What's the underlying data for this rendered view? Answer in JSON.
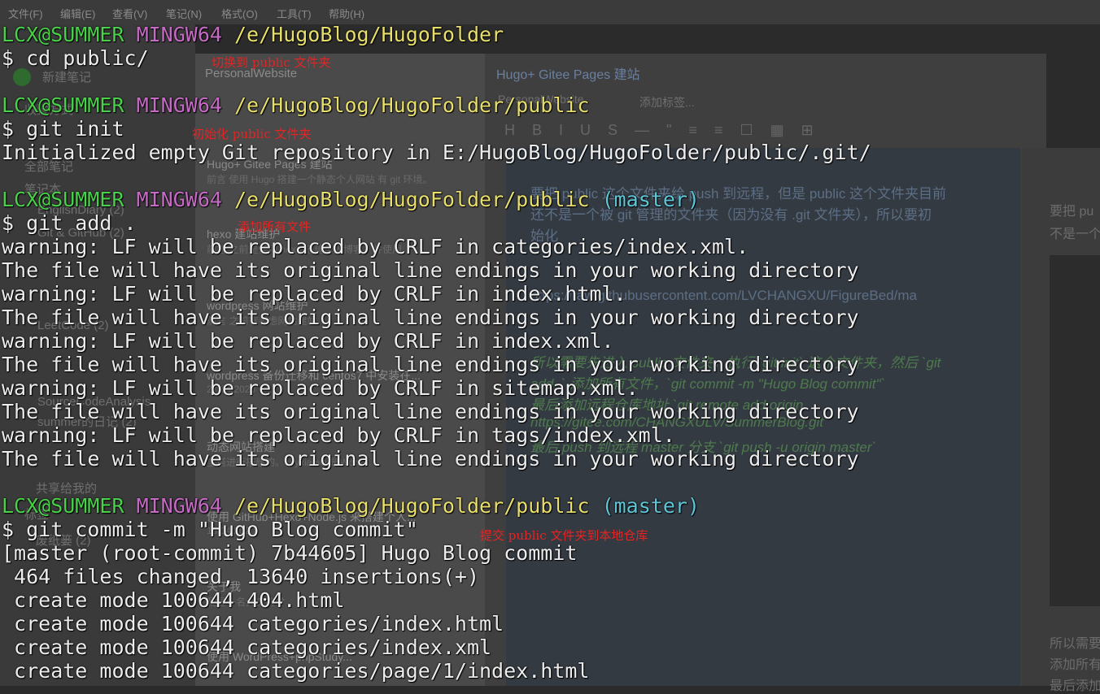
{
  "menu": [
    "文件(F)",
    "编辑(E)",
    "查看(V)",
    "笔记(N)",
    "格式(O)",
    "工具(T)",
    "帮助(H)"
  ],
  "sidebar": {
    "new_note": "新建笔记",
    "notebook_selector": "PersonalWebsite",
    "items": [
      "收藏方式",
      "全部笔记",
      "笔记本",
      "EnglishDiary (2)",
      "Git & GitHub (2)",
      "LeetCode (2)",
      "SourceCodeAnalysis",
      "summer的日记 (2)",
      "共享给我的",
      "标签",
      "废纸篓 (2)"
    ]
  },
  "note_list": [
    {
      "title": "Hugo+ Gitee Pages 建站",
      "snippet": "前言 使用 Hugo 搭建一个静态个人网站 有 git 环境。"
    },
    {
      "title": "hexo 建站维护",
      "snippet": "前言 之前是使用 hexo 搭建个人博客，并使用..."
    },
    {
      "title": "wordpress 网站维护",
      "snippet": "前言 之前有考虑网站建站"
    },
    {
      "title": "wordpress 备份迁移和 centos7 中安装在...",
      "snippet": "27/04/2020"
    },
    {
      "title": "动态网站搭建",
      "snippet": "宝塔进行搭建的。cxyxiaowu是Word..."
    },
    {
      "title": "使用 GitHub+Hexo+Node.js 来搭建个人...",
      "snippet": "19/04/2020"
    },
    {
      "title": "关于我",
      "snippet": "我是一名大二的学"
    },
    {
      "title": "使用 WordPress+phpStudy...",
      "snippet": ""
    }
  ],
  "editor": {
    "title": "Hugo+ Gitee Pages 建站",
    "notebook": "PersonalWebsite",
    "add_tag": "添加标签...",
    "paragraph_1": "要把 public 这个文件夹给 push 到远程，但是 public 这个文件夹目前",
    "paragraph_2": "还不是一个被 git 管理的文件夹（因为没有 .git 文件夹），所以要初",
    "paragraph_3": "始化",
    "url_line": "https://raw.githubusercontent.com/LVCHANGXU/FigureBed/ma",
    "step_1": "所以需要先进入 public 文件夹，执行 `git init` 这个文件夹，然后 `git",
    "step_2": "add .` 添加所有文件，`git commit -m \"Hugo Blog commit\"`",
    "step_3": "最后添加远程仓库地址 `git remote add origin",
    "step_4": "https://gitee.com/CHANGXULV/SummerBlog.git`",
    "step_5": "最后 push 到远程 master 分支 `git push -u origin master`",
    "right_1": "要把 pu",
    "right_2": "不是一个",
    "right_3": "所以需要",
    "right_4": "添加所有",
    "right_5": "最后添加"
  },
  "terminal": {
    "user": "LCX@SUMMER",
    "shell": "MINGW64",
    "branch": "(master)",
    "path_root": "/e/HugoBlog/HugoFolder",
    "path_public": "/e/HugoBlog/HugoFolder/public",
    "cmd_cd": "$ cd public/",
    "cmd_init": "$ git init",
    "out_init": "Initialized empty Git repository in E:/HugoBlog/HugoFolder/public/.git/",
    "cmd_add": "$ git add .",
    "warn_1": "warning: LF will be replaced by CRLF in categories/index.xml.",
    "warn_2": "warning: LF will be replaced by CRLF in index.html.",
    "warn_3": "warning: LF will be replaced by CRLF in index.xml.",
    "warn_4": "warning: LF will be replaced by CRLF in sitemap.xml.",
    "warn_5": "warning: LF will be replaced by CRLF in tags/index.xml.",
    "file_note": "The file will have its original line endings in your working directory",
    "cmd_commit": "$ git commit -m \"Hugo Blog commit\"",
    "out_commit": "[master (root-commit) 7b44605] Hugo Blog commit",
    "out_stats": " 464 files changed, 13640 insertions(+)",
    "create_1": " create mode 100644 404.html",
    "create_2": " create mode 100644 categories/index.html",
    "create_3": " create mode 100644 categories/index.xml",
    "create_4": " create mode 100644 categories/page/1/index.html"
  },
  "annotations": {
    "cd": "切换到 public 文件夹",
    "init": "初始化 public 文件夹",
    "add": "添加所有文件",
    "commit": "提交 public 文件夹到本地仓库"
  },
  "colors": {
    "user": "#49d149",
    "shell": "#c66ac6",
    "path": "#e8df6a",
    "branch": "#5fc6d8",
    "annotation": "#e52424"
  }
}
